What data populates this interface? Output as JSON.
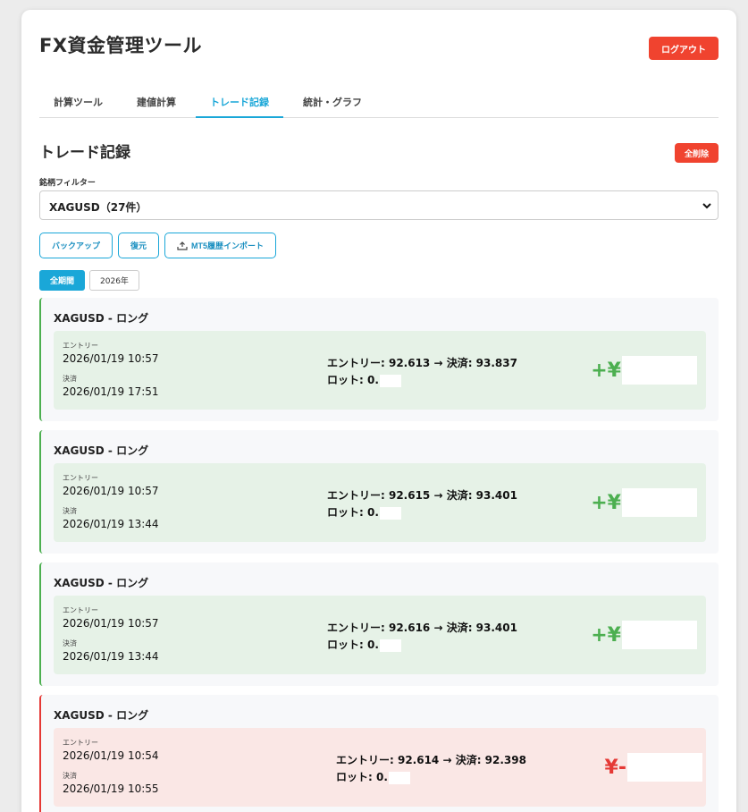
{
  "app": {
    "title": "FX資金管理ツール",
    "logout_label": "ログアウト"
  },
  "tabs": [
    {
      "label": "計算ツール",
      "active": false
    },
    {
      "label": "建値計算",
      "active": false
    },
    {
      "label": "トレード記録",
      "active": true
    },
    {
      "label": "統計・グラフ",
      "active": false
    }
  ],
  "section": {
    "title": "トレード記録",
    "delete_all_label": "全削除"
  },
  "filter": {
    "label": "銘柄フィルター",
    "selected": "XAGUSD（27件）"
  },
  "actions": {
    "backup_label": "バックアップ",
    "restore_label": "復元",
    "import_label": "MT5履歴インポート"
  },
  "periods": [
    {
      "label": "全期間",
      "active": true
    },
    {
      "label": "2026年",
      "active": false
    }
  ],
  "trades": [
    {
      "title": "XAGUSD - ロング",
      "entry_label": "エントリー",
      "entry_time": "2026/01/19 10:57",
      "exit_label": "決済",
      "exit_time": "2026/01/19 17:51",
      "prices": "エントリー: 92.613 → 決済: 93.837",
      "lot": "ロット: 0.",
      "pnl_prefix": "+¥",
      "result": "win"
    },
    {
      "title": "XAGUSD - ロング",
      "entry_label": "エントリー",
      "entry_time": "2026/01/19 10:57",
      "exit_label": "決済",
      "exit_time": "2026/01/19 13:44",
      "prices": "エントリー: 92.615 → 決済: 93.401",
      "lot": "ロット: 0.",
      "pnl_prefix": "+¥",
      "result": "win"
    },
    {
      "title": "XAGUSD - ロング",
      "entry_label": "エントリー",
      "entry_time": "2026/01/19 10:57",
      "exit_label": "決済",
      "exit_time": "2026/01/19 13:44",
      "prices": "エントリー: 92.616 → 決済: 93.401",
      "lot": "ロット: 0.",
      "pnl_prefix": "+¥",
      "result": "win"
    },
    {
      "title": "XAGUSD - ロング",
      "entry_label": "エントリー",
      "entry_time": "2026/01/19 10:54",
      "exit_label": "決済",
      "exit_time": "2026/01/19 10:55",
      "prices": "エントリー: 92.614 → 決済: 92.398",
      "lot": "ロット: 0.",
      "pnl_prefix": "¥-",
      "result": "loss"
    }
  ],
  "colors": {
    "accent": "#1aa7d8",
    "danger": "#f0432f",
    "win": "#4caf50",
    "loss": "#e53935",
    "win_bg": "#e6f2e7",
    "loss_bg": "#fae7e5"
  }
}
